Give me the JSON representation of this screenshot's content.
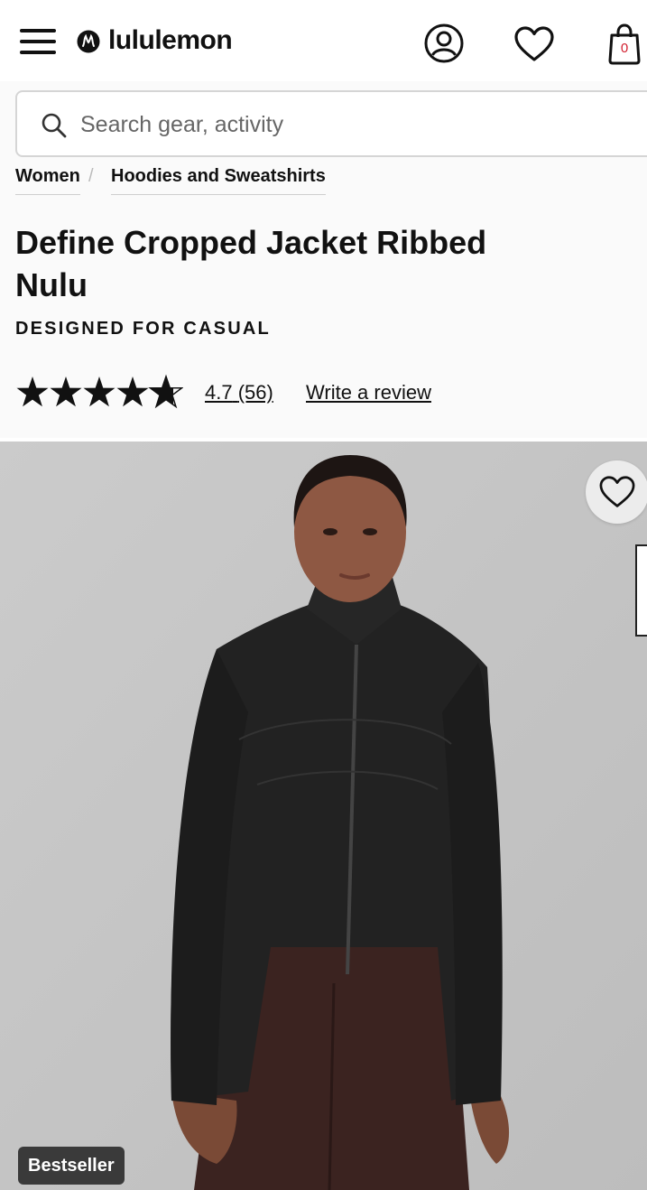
{
  "header": {
    "brand": "lululemon",
    "menu_icon": "hamburger-menu-icon",
    "account_icon": "user-account-icon",
    "wishlist_icon": "heart-icon",
    "bag_icon": "shopping-bag-icon",
    "bag_count": "0"
  },
  "search": {
    "placeholder": "Search gear, activity",
    "value": ""
  },
  "breadcrumb": {
    "items": [
      "Women",
      "Hoodies and Sweatshirts"
    ],
    "separator": "/"
  },
  "product": {
    "title": "Define Cropped Jacket Ribbed Nulu",
    "designed_for": "DESIGNED FOR CASUAL",
    "rating": "4.7",
    "review_count": "(56)",
    "rating_stars_value": 4.7,
    "rating_stars_max": 5,
    "write_review_label": "Write a review"
  },
  "hero": {
    "badge": "Bestseller",
    "favorite_icon": "heart-outline-icon",
    "background_color": "#c4c4c4"
  },
  "colors": {
    "text": "#111111",
    "bag_count": "#d22030",
    "badge_bg": "#3a3a3a"
  }
}
